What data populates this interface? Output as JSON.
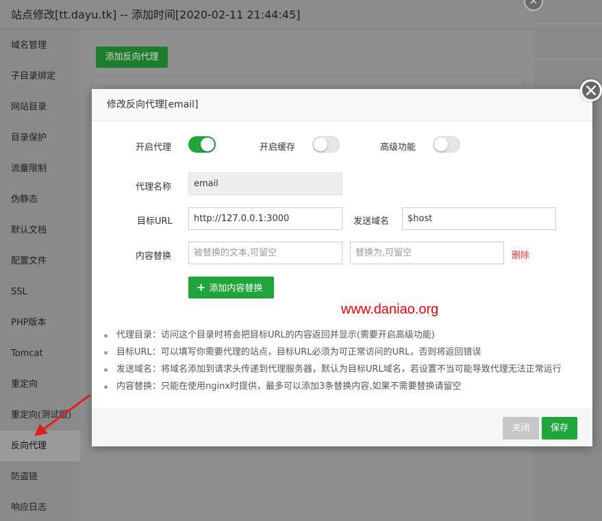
{
  "window": {
    "title": "站点修改[tt.dayu.tk] -- 添加时间[2020-02-11 21:44:45]"
  },
  "sidebar": {
    "items": [
      {
        "label": "域名管理"
      },
      {
        "label": "子目录绑定"
      },
      {
        "label": "网站目录"
      },
      {
        "label": "目录保护"
      },
      {
        "label": "流量限制"
      },
      {
        "label": "伪静态"
      },
      {
        "label": "默认文档"
      },
      {
        "label": "配置文件"
      },
      {
        "label": "SSL"
      },
      {
        "label": "PHP版本"
      },
      {
        "label": "Tomcat"
      },
      {
        "label": "重定向"
      },
      {
        "label": "重定向(测试版)"
      },
      {
        "label": "反向代理",
        "active": true
      },
      {
        "label": "防盗链"
      },
      {
        "label": "响应日志"
      }
    ]
  },
  "content": {
    "add_proxy_button": "添加反向代理"
  },
  "modal": {
    "title": "修改反向代理[email]",
    "toggles": {
      "enable_proxy": {
        "label": "开启代理",
        "on": true
      },
      "enable_cache": {
        "label": "开启缓存",
        "on": false
      },
      "advanced": {
        "label": "高级功能",
        "on": false
      }
    },
    "form": {
      "proxy_name_label": "代理名称",
      "proxy_name_value": "email",
      "target_url_label": "目标URL",
      "target_url_value": "http://127.0.0.1:3000",
      "send_domain_label": "发送域名",
      "send_domain_value": "$host",
      "replace_label": "内容替换",
      "replace_from_placeholder": "被替换的文本,可留空",
      "replace_to_placeholder": "替换为,可留空",
      "delete_label": "删除",
      "add_replace_button": "添加内容替换"
    },
    "watermark": "www.daniao.org",
    "notes": [
      "代理目录：访问这个目录时将会把目标URL的内容返回并显示(需要开启高级功能)",
      "目标URL：可以填写你需要代理的站点，目标URL必须为可正常访问的URL，否则将返回错误",
      "发送域名：将域名添加到请求头传递到代理服务器，默认为目标URL域名，若设置不当可能导致代理无法正常运行",
      "内容替换：只能在使用nginx时提供，最多可以添加3条替换内容,如果不需要替换请留空"
    ],
    "footer": {
      "close_label": "关闭",
      "save_label": "保存"
    }
  },
  "colors": {
    "accent_green": "#20a53a",
    "danger_red": "#e33333",
    "watermark_red": "#e8000d",
    "annotation_arrow": "#e02020"
  }
}
